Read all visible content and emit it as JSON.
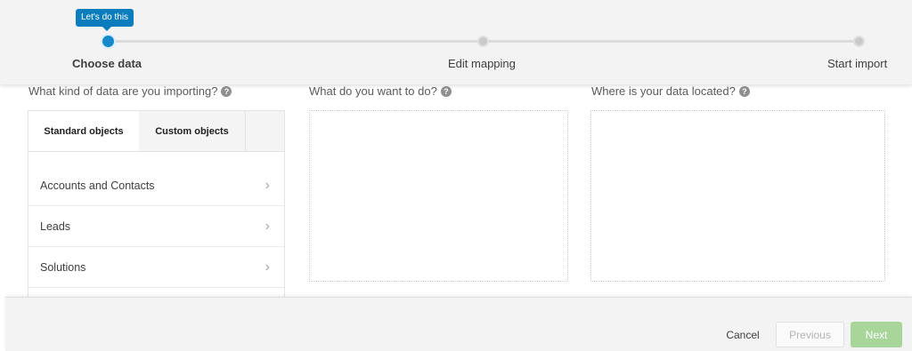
{
  "progress": {
    "tooltip": "Let's do this",
    "steps": [
      {
        "label": "Choose data",
        "state": "active"
      },
      {
        "label": "Edit mapping",
        "state": "inactive"
      },
      {
        "label": "Start import",
        "state": "inactive"
      }
    ]
  },
  "columns": {
    "data_kind": {
      "title": "What kind of data are you importing?",
      "help_icon": "question-circle-icon"
    },
    "action": {
      "title": "What do you want to do?",
      "help_icon": "question-circle-icon"
    },
    "location": {
      "title": "Where is your data located?",
      "help_icon": "question-circle-icon"
    }
  },
  "objects": {
    "tabs": [
      {
        "label": "Standard objects",
        "selected": true
      },
      {
        "label": "Custom objects",
        "selected": false
      }
    ],
    "items": [
      {
        "label": "Accounts and Contacts",
        "icon": "chevron-right-icon"
      },
      {
        "label": "Leads",
        "icon": "chevron-right-icon"
      },
      {
        "label": "Solutions",
        "icon": "chevron-right-icon"
      }
    ]
  },
  "footer": {
    "cancel_label": "Cancel",
    "previous_label": "Previous",
    "next_label": "Next"
  },
  "colors": {
    "accent": "#1589c9",
    "next_button": "#a7d59a",
    "header_bg": "#f3f3f3"
  }
}
